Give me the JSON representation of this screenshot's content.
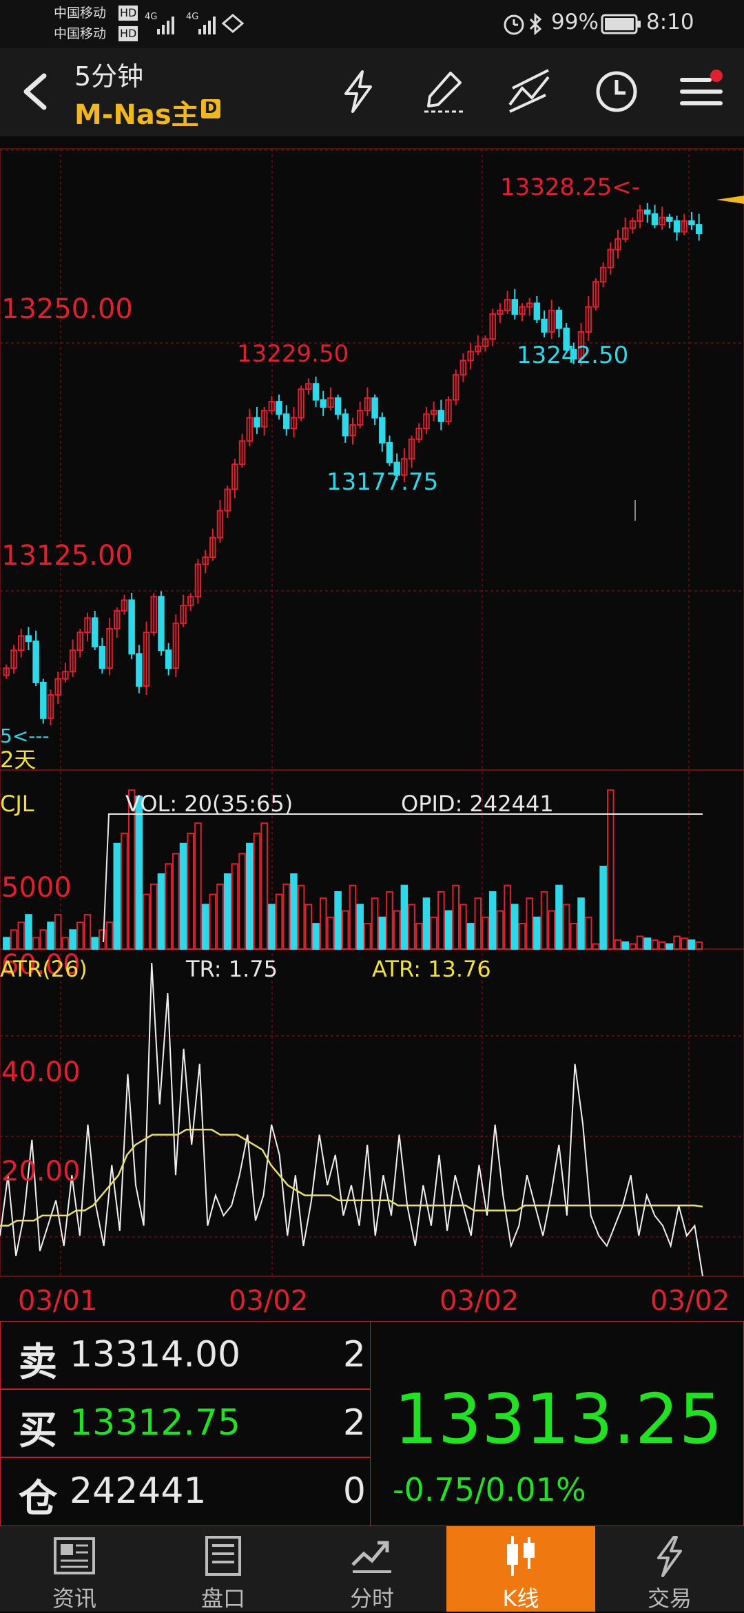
{
  "status_bar": {
    "carrier1": "中国移动",
    "carrier2": "中国移动",
    "hd": "HD",
    "net": "4G",
    "battery": "99%",
    "time": "8:10"
  },
  "header": {
    "period": "5分钟",
    "symbol": "M-Nas主",
    "badge": "D"
  },
  "price_chart": {
    "y_labels": [
      "13250.00",
      "13125.00"
    ],
    "ann_high_left": "13229.50",
    "ann_low_mid": "13177.75",
    "ann_low_right": "13242.50",
    "ann_high_right": "13328.25<-",
    "marker_left": "5<---",
    "marker_days": "2天"
  },
  "volume_panel": {
    "title": "CJL",
    "vol_label": "VOL: 20(35:65)",
    "opid_label": "OPID: 242441",
    "y_label": "5000"
  },
  "atr_panel": {
    "title": "ATR(26)",
    "tr_label": "TR: 1.75",
    "atr_label": "ATR: 13.76",
    "y_labels": [
      "60.00",
      "40.00",
      "20.00"
    ]
  },
  "x_labels": [
    "03/01",
    "03/02",
    "03/02",
    "03/02"
  ],
  "quote": {
    "sell_label": "卖",
    "sell_price": "13314.00",
    "sell_qty": "2",
    "buy_label": "买",
    "buy_price": "13312.75",
    "buy_qty": "2",
    "pos_label": "仓",
    "pos_value": "242441",
    "pos_qty": "0",
    "last_price": "13313.25",
    "change": "-0.75/0.01%"
  },
  "nav": [
    {
      "label": "资讯",
      "icon": "news-icon"
    },
    {
      "label": "盘口",
      "icon": "orderbook-icon"
    },
    {
      "label": "分时",
      "icon": "timeshare-icon"
    },
    {
      "label": "K线",
      "icon": "candlestick-icon"
    },
    {
      "label": "交易",
      "icon": "trade-icon"
    }
  ],
  "colors": {
    "up": "#e02030",
    "down": "#2fd8e8",
    "accent": "#f07810",
    "gain": "#22e022",
    "symbol": "#f0b81e"
  },
  "chart_data": {
    "type": "candlestick",
    "price_series": {
      "x": [
        0,
        4,
        8,
        12,
        16,
        20,
        24,
        28,
        32,
        36,
        40,
        44,
        48,
        52,
        56,
        60,
        64,
        68,
        72,
        76,
        80,
        84,
        88,
        92,
        96,
        100,
        104,
        108,
        112,
        116,
        120,
        124,
        128,
        132,
        136,
        140,
        144,
        148,
        152,
        156,
        160,
        164,
        168,
        172,
        176,
        180,
        184,
        188,
        192,
        196,
        200,
        204,
        208,
        212,
        216,
        220,
        224,
        228,
        232,
        236,
        240,
        244,
        248,
        252,
        256,
        260,
        264,
        268,
        272,
        276,
        280,
        284,
        288,
        292,
        296,
        300,
        304,
        308,
        312,
        316,
        320,
        324,
        328,
        332,
        336,
        340,
        344,
        348,
        352,
        356,
        360,
        364,
        368,
        372,
        376,
        380,
        384,
        388,
        392,
        396,
        400,
        404,
        408,
        412,
        416,
        420,
        424,
        428,
        432,
        436,
        440,
        444,
        448,
        452,
        456,
        460,
        464,
        468,
        472,
        476,
        480,
        484,
        488,
        492,
        496,
        500,
        504,
        508,
        512,
        516,
        520,
        524,
        528,
        532,
        536,
        540,
        544,
        548,
        552,
        556,
        560,
        564,
        568,
        572,
        576,
        580,
        584,
        588,
        592,
        596,
        600,
        604,
        608,
        612,
        616,
        620,
        624,
        628,
        632,
        636,
        640,
        644,
        648,
        652,
        656,
        660,
        664,
        668,
        672,
        676
      ],
      "close": [
        13070,
        13080,
        13088,
        13085,
        13062,
        13042,
        13055,
        13064,
        13068,
        13080,
        13090,
        13098,
        13082,
        13070,
        13092,
        13102,
        13108,
        13078,
        13060,
        13090,
        13110,
        13080,
        13070,
        13095,
        13105,
        13110,
        13128,
        13132,
        13143,
        13158,
        13170,
        13184,
        13197,
        13210,
        13205,
        13214,
        13219,
        13212,
        13204,
        13210,
        13226,
        13229,
        13220,
        13216,
        13221,
        13212,
        13200,
        13206,
        13214,
        13221,
        13210,
        13196,
        13185,
        13178,
        13187,
        13198,
        13204,
        13212,
        13214,
        13208,
        13220,
        13234,
        13242,
        13247,
        13250,
        13254,
        13268,
        13270,
        13276,
        13268,
        13272,
        13274,
        13265,
        13258,
        13270,
        13260,
        13248,
        13243,
        13258,
        13272,
        13286,
        13294,
        13304,
        13310,
        13316,
        13320,
        13326,
        13324,
        13318,
        13322,
        13320,
        13314,
        13320,
        13318,
        13313
      ],
      "high": 13328.25,
      "low": 13040,
      "ylim": [
        13040,
        13345
      ]
    },
    "volume": {
      "ylim": [
        0,
        13000
      ],
      "tick": 5000
    },
    "atr": {
      "ylim": [
        0,
        62
      ],
      "ticks": [
        20,
        40,
        60
      ],
      "tr": [
        8,
        20,
        4,
        12,
        27,
        5,
        10,
        15,
        6,
        20,
        8,
        30,
        14,
        6,
        22,
        9,
        40,
        18,
        10,
        62,
        34,
        56,
        20,
        45,
        26,
        42,
        10,
        16,
        12,
        14,
        20,
        28,
        11,
        16,
        30,
        24,
        8,
        20,
        6,
        15,
        28,
        18,
        24,
        12,
        18,
        10,
        26,
        8,
        20,
        12,
        28,
        14,
        6,
        18,
        10,
        24,
        9,
        20,
        14,
        8,
        22,
        12,
        30,
        16,
        6,
        10,
        20,
        14,
        8,
        16,
        26,
        12,
        42,
        30,
        12,
        8,
        6,
        10,
        14,
        20,
        8,
        16,
        12,
        10,
        6,
        14,
        8,
        10,
        0
      ],
      "atr_line": [
        10,
        10,
        11,
        11,
        11,
        12,
        12,
        12,
        12,
        13,
        13,
        14,
        16,
        18,
        20,
        24,
        26,
        27,
        28,
        28,
        28,
        28,
        29,
        29,
        29,
        29,
        28,
        28,
        28,
        27,
        26,
        25,
        22,
        20,
        18,
        17,
        16,
        16,
        16,
        16,
        15,
        15,
        15,
        15,
        15,
        15,
        15,
        14,
        14,
        14,
        14,
        14,
        14,
        14,
        14,
        14,
        13,
        13,
        13,
        13,
        13,
        13,
        14,
        14,
        14,
        14,
        14,
        14,
        14,
        14,
        14,
        14,
        14,
        14,
        14,
        14,
        14,
        14,
        14,
        14,
        14,
        14,
        14,
        13.76
      ]
    }
  }
}
